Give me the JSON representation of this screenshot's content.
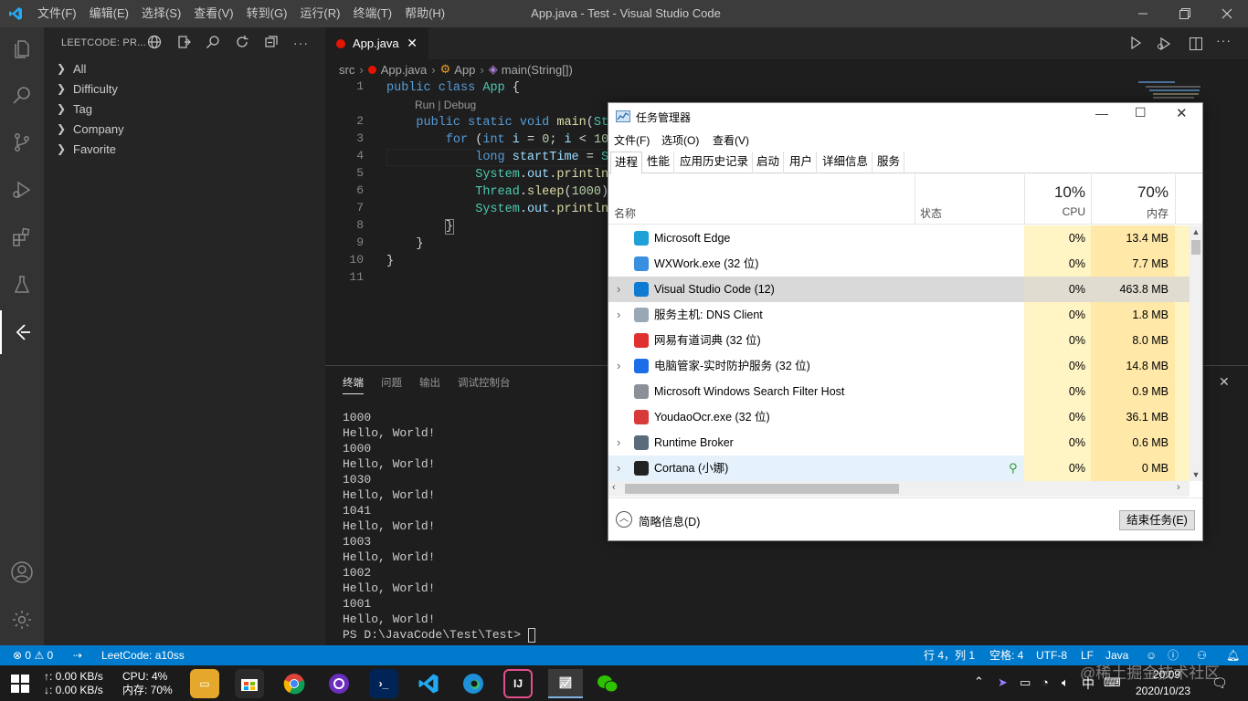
{
  "titlebar": {
    "menus": [
      "文件(F)",
      "编辑(E)",
      "选择(S)",
      "查看(V)",
      "转到(G)",
      "运行(R)",
      "终端(T)",
      "帮助(H)"
    ],
    "title": "App.java - Test - Visual Studio Code"
  },
  "sidebar": {
    "header": "LEETCODE: PR...",
    "items": [
      {
        "label": "All"
      },
      {
        "label": "Difficulty"
      },
      {
        "label": "Tag"
      },
      {
        "label": "Company"
      },
      {
        "label": "Favorite"
      }
    ]
  },
  "editor": {
    "tab": "App.java",
    "breadcrumb": [
      "src",
      "App.java",
      "App",
      "main(String[])"
    ],
    "codelens": "Run | Debug",
    "line_numbers": [
      "1",
      "2",
      "3",
      "4",
      "5",
      "6",
      "7",
      "8",
      "9",
      "10",
      "11"
    ]
  },
  "panel": {
    "tabs": [
      "终端",
      "问题",
      "输出",
      "调试控制台"
    ],
    "terminal_lines": [
      "1000",
      "Hello, World!",
      "1000",
      "Hello, World!",
      "1030",
      "Hello, World!",
      "1041",
      "Hello, World!",
      "1003",
      "Hello, World!",
      "1002",
      "Hello, World!",
      "1001",
      "Hello, World!",
      "PS D:\\JavaCode\\Test\\Test> "
    ]
  },
  "statusbar": {
    "errors": "0",
    "warnings": "0",
    "leetcode": "LeetCode: a10ss",
    "position": "行 4，列 1",
    "spaces": "空格: 4",
    "encoding": "UTF-8",
    "eol": "LF",
    "language": "Java"
  },
  "taskmanager": {
    "title": "任务管理器",
    "menus": [
      "文件(F)",
      "选项(O)",
      "查看(V)"
    ],
    "tabs": [
      "进程",
      "性能",
      "应用历史记录",
      "启动",
      "用户",
      "详细信息",
      "服务"
    ],
    "columns": {
      "name": "名称",
      "status": "状态",
      "cpu_pct": "10%",
      "cpu": "CPU",
      "mem_pct": "70%",
      "mem": "内存"
    },
    "rows": [
      {
        "name": "Microsoft Edge",
        "cpu": "0%",
        "mem": "13.4 MB",
        "expand": false,
        "icon_color": "#1ea0d8"
      },
      {
        "name": "WXWork.exe (32 位)",
        "cpu": "0%",
        "mem": "7.7 MB",
        "expand": false,
        "icon_color": "#3b8fe0"
      },
      {
        "name": "Visual Studio Code (12)",
        "cpu": "0%",
        "mem": "463.8 MB",
        "expand": true,
        "icon_color": "#0e7ad2"
      },
      {
        "name": "服务主机: DNS Client",
        "cpu": "0%",
        "mem": "1.8 MB",
        "expand": true,
        "icon_color": "#9aa7b5"
      },
      {
        "name": "网易有道词典 (32 位)",
        "cpu": "0%",
        "mem": "8.0 MB",
        "expand": false,
        "icon_color": "#e03030"
      },
      {
        "name": "电脑管家-实时防护服务 (32 位)",
        "cpu": "0%",
        "mem": "14.8 MB",
        "expand": true,
        "icon_color": "#1c6ee8"
      },
      {
        "name": "Microsoft Windows Search Filter Host",
        "cpu": "0%",
        "mem": "0.9 MB",
        "expand": false,
        "icon_color": "#8a8f98"
      },
      {
        "name": "YoudaoOcr.exe (32 位)",
        "cpu": "0%",
        "mem": "36.1 MB",
        "expand": false,
        "icon_color": "#d83a3a"
      },
      {
        "name": "Runtime Broker",
        "cpu": "0%",
        "mem": "0.6 MB",
        "expand": true,
        "icon_color": "#5a6b7c"
      },
      {
        "name": "Cortana (小娜)",
        "cpu": "0%",
        "mem": "0 MB",
        "expand": true,
        "icon_color": "#222222"
      }
    ],
    "fewer_details": "简略信息(D)",
    "end_task": "结束任务(E)"
  },
  "taskbar": {
    "net_up": "↑: 0.00 KB/s",
    "net_down": "↓: 0.00 KB/s",
    "cpu": "CPU: 4%",
    "mem": "内存: 70%",
    "ime": "中",
    "time": "20:09",
    "date": "2020/10/23",
    "watermark": "@稀土掘金技术社区"
  }
}
